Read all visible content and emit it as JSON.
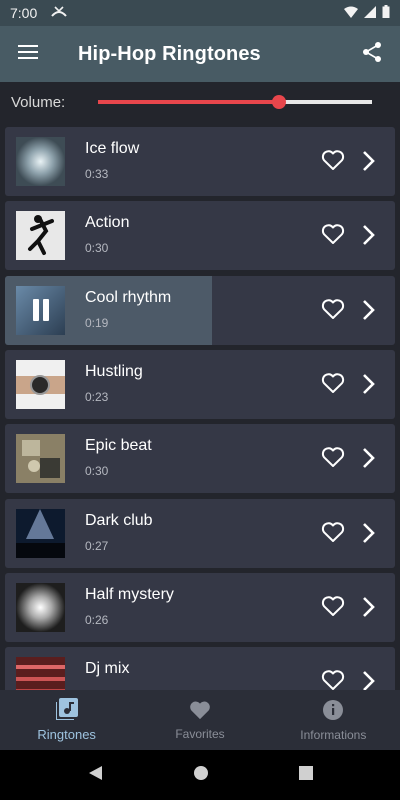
{
  "status_bar": {
    "time": "7:00"
  },
  "app_bar": {
    "title": "Hip-Hop Ringtones"
  },
  "volume": {
    "label": "Volume:",
    "level": 0.66
  },
  "ringtones": [
    {
      "title": "Ice flow",
      "duration": "0:33",
      "thumb": "ice"
    },
    {
      "title": "Action",
      "duration": "0:30",
      "thumb": "dancer"
    },
    {
      "title": "Cool rhythm",
      "duration": "0:19",
      "thumb": "cool",
      "playing": true,
      "progress": 0.53
    },
    {
      "title": "Hustling",
      "duration": "0:23",
      "thumb": "watch"
    },
    {
      "title": "Epic beat",
      "duration": "0:30",
      "thumb": "grunge"
    },
    {
      "title": "Dark club",
      "duration": "0:27",
      "thumb": "club"
    },
    {
      "title": "Half mystery",
      "duration": "0:26",
      "thumb": "smoke"
    },
    {
      "title": "Dj mix",
      "duration": "",
      "thumb": "mixer"
    }
  ],
  "bottom_nav": {
    "ringtones": "Ringtones",
    "favorites": "Favorites",
    "informations": "Informations"
  },
  "colors": {
    "accent": "#e8464c",
    "app_bar": "#485b64",
    "background": "#23252c",
    "card": "#353846",
    "active_tab": "#9ec3df"
  }
}
